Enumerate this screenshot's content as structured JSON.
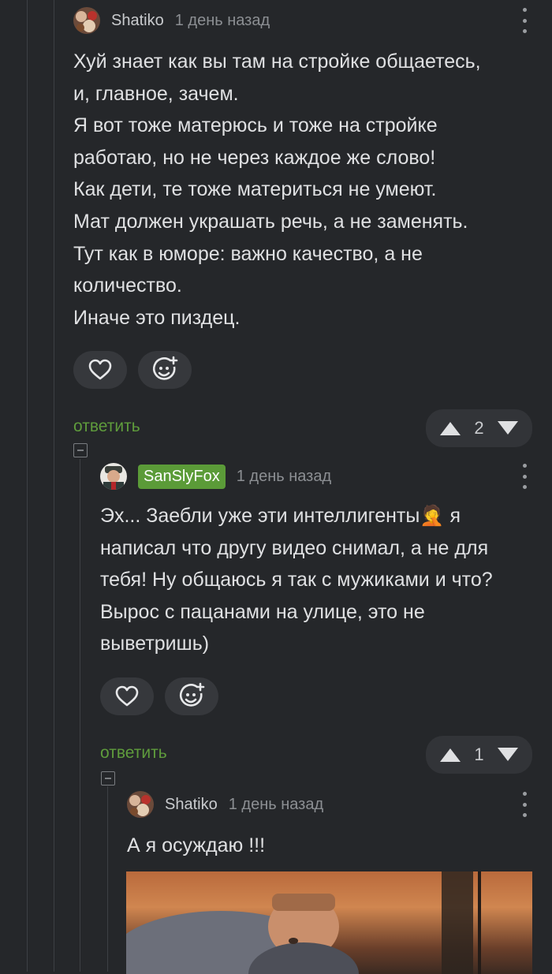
{
  "comments": [
    {
      "username": "Shatiko",
      "time": "1 день назад",
      "lines": [
        "Хуй знает как вы там на стройке общаетесь,",
        "и, главное, зачем.",
        "Я вот тоже матерюсь и тоже на стройке",
        "работаю, но не через каждое же слово!",
        "Как дети, те тоже материться не умеют.",
        "Мат должен украшать речь, а не заменять.",
        "Тут как в юморе: важно качество, а не",
        "количество.",
        "Иначе это пиздец."
      ],
      "reply_label": "ответить",
      "rating": "2"
    },
    {
      "username": "SanSlyFox",
      "time": "1 день назад",
      "text_part1": "Эх... Заебли уже эти интеллигенты",
      "emoji": "🤦",
      "text_part2": " я",
      "lines": [
        "написал что другу видео снимал, а не для",
        "тебя! Ну общаюсь я так с мужиками и что?",
        "Вырос с пацанами на улице, это не",
        "выветришь)"
      ],
      "reply_label": "ответить",
      "rating": "1"
    },
    {
      "username": "Shatiko",
      "time": "1 день назад",
      "text": "А я осуждаю !!!"
    }
  ],
  "icons": {
    "like": "heart-icon",
    "reaction": "add-reaction-icon",
    "upvote": "triangle-up-icon",
    "downvote": "triangle-down-icon",
    "menu": "more-vertical-icon",
    "collapse": "collapse-thread-icon"
  },
  "colors": {
    "background": "#25272a",
    "accent": "#5f9c3c",
    "badge": "#5b9b38",
    "pill": "#36383c"
  }
}
